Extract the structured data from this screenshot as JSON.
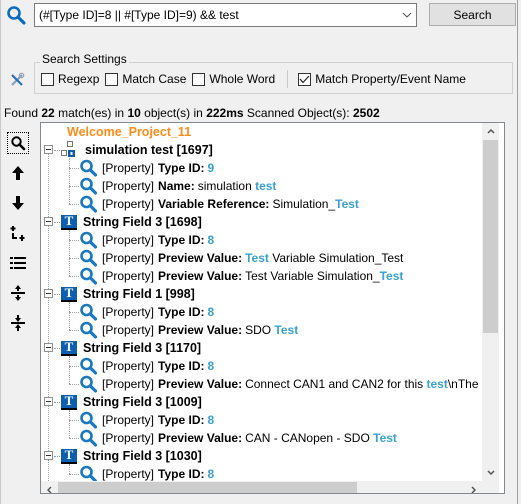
{
  "search": {
    "query": "(#[Type ID]=8 || #[Type ID]=9) && test",
    "button_label": "Search"
  },
  "settings": {
    "legend": "Search Settings",
    "options": [
      {
        "label": "Regexp",
        "checked": false
      },
      {
        "label": "Match Case",
        "checked": false
      },
      {
        "label": "Whole Word",
        "checked": false
      },
      {
        "label": "Match Property/Event Name",
        "checked": true
      }
    ]
  },
  "status": {
    "found_prefix": "Found",
    "matches": "22",
    "matches_suffix": "match(es) in",
    "objects": "10",
    "objects_suffix": "object(s) in",
    "time": "222ms",
    "scanned_label": "Scanned Object(s):",
    "scanned": "2502"
  },
  "toolbar": {
    "buttons": [
      {
        "name": "find",
        "icon": "magnifier-icon"
      },
      {
        "name": "previous",
        "icon": "arrow-up-icon"
      },
      {
        "name": "next",
        "icon": "arrow-down-icon"
      },
      {
        "name": "hierarchy",
        "icon": "hierarchy-icon"
      },
      {
        "name": "list",
        "icon": "list-icon"
      },
      {
        "name": "expand-all",
        "icon": "expand-icon"
      },
      {
        "name": "collapse-all",
        "icon": "collapse-icon"
      }
    ]
  },
  "tree": {
    "root": "Welcome_Project_11",
    "property_prefix": "[Property]",
    "objects": [
      {
        "label": "simulation test [1697]",
        "icon": "simulation-icon",
        "properties": [
          {
            "name": "Type ID:",
            "parts": [
              {
                "t": "9",
                "hl": true
              }
            ]
          },
          {
            "name": "Name:",
            "parts": [
              {
                "t": "simulation ",
                "hl": false
              },
              {
                "t": "test",
                "hl": true
              }
            ]
          },
          {
            "name": "Variable Reference:",
            "parts": [
              {
                "t": "Simulation_",
                "hl": false
              },
              {
                "t": "Test",
                "hl": true
              }
            ]
          }
        ]
      },
      {
        "label": "String Field 3 [1698]",
        "icon": "text-field-icon",
        "properties": [
          {
            "name": "Type ID:",
            "parts": [
              {
                "t": "8",
                "hl": true
              }
            ]
          },
          {
            "name": "Preview Value:",
            "parts": [
              {
                "t": "Test",
                "hl": true
              },
              {
                "t": " Variable Simulation_Test",
                "hl": false
              }
            ]
          },
          {
            "name": "Preview Value:",
            "parts": [
              {
                "t": "Test Variable Simulation_",
                "hl": false
              },
              {
                "t": "Test",
                "hl": true
              }
            ]
          }
        ]
      },
      {
        "label": "String Field 1 [998]",
        "icon": "text-field-icon",
        "properties": [
          {
            "name": "Type ID:",
            "parts": [
              {
                "t": "8",
                "hl": true
              }
            ]
          },
          {
            "name": "Preview Value:",
            "parts": [
              {
                "t": "SDO ",
                "hl": false
              },
              {
                "t": "Test",
                "hl": true
              }
            ]
          }
        ]
      },
      {
        "label": "String Field 3 [1170]",
        "icon": "text-field-icon",
        "properties": [
          {
            "name": "Type ID:",
            "parts": [
              {
                "t": "8",
                "hl": true
              }
            ]
          },
          {
            "name": "Preview Value:",
            "parts": [
              {
                "t": "Connect CAN1 and CAN2 for this ",
                "hl": false
              },
              {
                "t": "test",
                "hl": true
              },
              {
                "t": "\\nThe ECU will",
                "hl": false
              }
            ]
          }
        ]
      },
      {
        "label": "String Field 3 [1009]",
        "icon": "text-field-icon",
        "properties": [
          {
            "name": "Type ID:",
            "parts": [
              {
                "t": "8",
                "hl": true
              }
            ]
          },
          {
            "name": "Preview Value:",
            "parts": [
              {
                "t": "CAN - CANopen - SDO ",
                "hl": false
              },
              {
                "t": "Test",
                "hl": true
              }
            ]
          }
        ]
      },
      {
        "label": "String Field 3 [1030]",
        "icon": "text-field-icon",
        "properties": [
          {
            "name": "Type ID:",
            "parts": [
              {
                "t": "8",
                "hl": true
              }
            ]
          }
        ]
      }
    ]
  },
  "scroll": {
    "vertical_thumb_fraction": 0.6,
    "horizontal_thumb_fraction": 0.73
  },
  "colors": {
    "root": "#ff8c1a",
    "highlight": "#3aa0d0",
    "icon_blue": "#0b5fae"
  }
}
